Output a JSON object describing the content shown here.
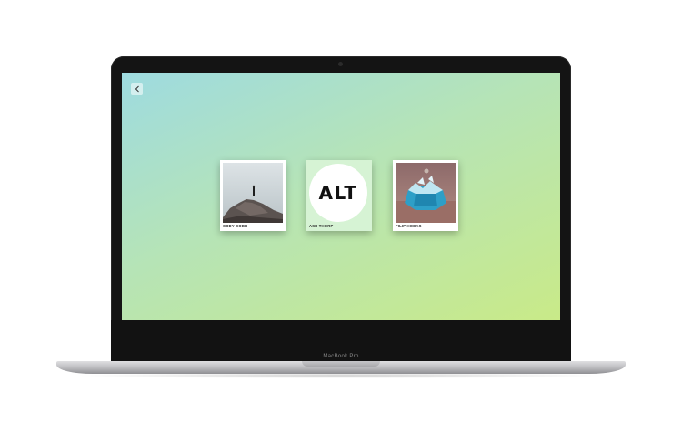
{
  "device": {
    "model_label": "MacBook Pro"
  },
  "toolbar": {
    "back_icon": "chevron-left-icon"
  },
  "cards": [
    {
      "label": "CODY COBB",
      "thumbnail": "person-standing-on-rock-photo"
    },
    {
      "label": "ASH THORP",
      "logo_text": "ALT"
    },
    {
      "label": "FILIP HODAS",
      "thumbnail": "blue-crystal-block-photo"
    }
  ],
  "colors": {
    "screen_gradient_start": "#9edbe0",
    "screen_gradient_end": "#c9ea88",
    "featured_card_bg": "#d6f3d4"
  }
}
